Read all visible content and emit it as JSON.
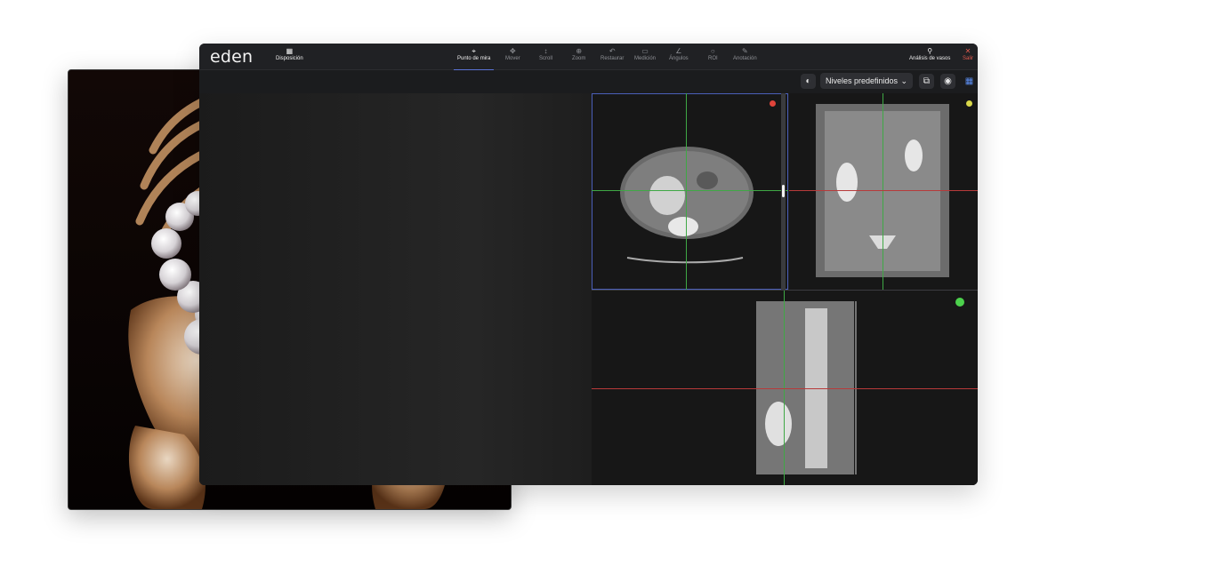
{
  "app": {
    "logo": "eden",
    "layout_label": "Disposición",
    "tools": [
      {
        "label": "Punto de mira",
        "icon": "crosshair-icon",
        "active": true
      },
      {
        "label": "Mover",
        "icon": "move-icon",
        "active": false
      },
      {
        "label": "Scroll",
        "icon": "scroll-icon",
        "active": false
      },
      {
        "label": "Zoom",
        "icon": "zoom-icon",
        "active": false
      },
      {
        "label": "Restaurar",
        "icon": "restore-icon",
        "active": false
      },
      {
        "label": "Medición",
        "icon": "ruler-icon",
        "active": false
      },
      {
        "label": "Ángulos",
        "icon": "angle-icon",
        "active": false
      },
      {
        "label": "ROI",
        "icon": "roi-circle-icon",
        "active": false
      },
      {
        "label": "Anotación",
        "icon": "pencil-icon",
        "active": false
      }
    ],
    "vessel_label": "Análisis de vasos",
    "exit_label": "Salir",
    "preset_label": "Niveles predefinidos"
  },
  "colors": {
    "accent": "#5a73d6",
    "dot_red": "#e0443a",
    "dot_yellow": "#d9d84a",
    "dot_green": "#4cd14c",
    "line_green": "#3fa845",
    "line_red": "#b73a3a"
  }
}
